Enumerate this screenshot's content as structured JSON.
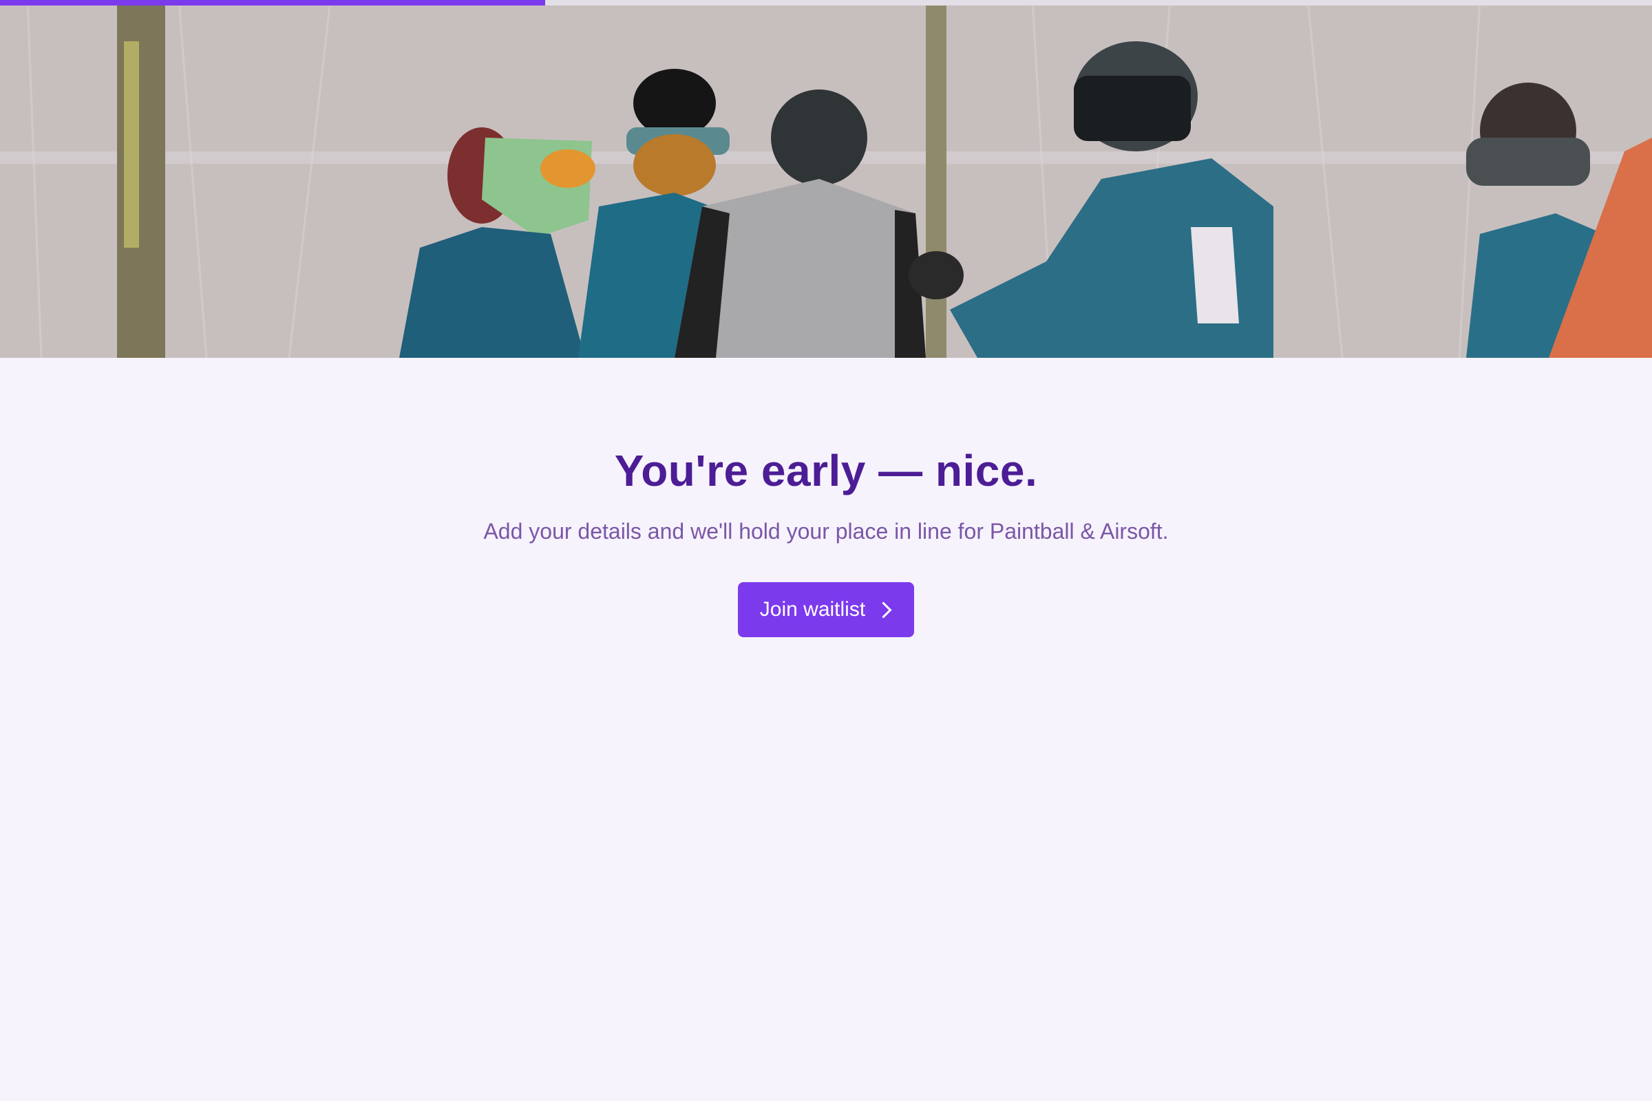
{
  "progress": {
    "fraction": 0.33,
    "fill_color": "#7c3aed"
  },
  "hero": {
    "image_name": "paintball-team-hero-image"
  },
  "headline": "You're early — nice.",
  "subtitle": "Add your details and we'll hold your place in line for Paintball & Airsoft.",
  "cta": {
    "label": "Join waitlist",
    "icon": "chevron-right-icon"
  },
  "colors": {
    "background": "#f6f3fd",
    "headline": "#4c1d95",
    "subtitle": "#7b56a6",
    "accent": "#7c3aed"
  }
}
